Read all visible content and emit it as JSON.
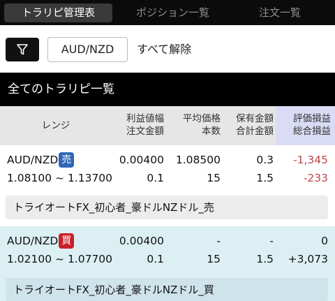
{
  "tabs": [
    {
      "label": "トラリピ管理表",
      "active": true
    },
    {
      "label": "ポジション一覧",
      "active": false
    },
    {
      "label": "注文一覧",
      "active": false
    }
  ],
  "filter": {
    "icon": "filter-icon",
    "pair": "AUD/NZD",
    "clear_label": "すべて解除"
  },
  "section_title": "全てのトラリピ一覧",
  "table_header": {
    "range": "レンジ",
    "col1": [
      "利益値幅",
      "注文金額"
    ],
    "col2": [
      "平均価格",
      "本数"
    ],
    "col3": [
      "保有金額",
      "合計金額"
    ],
    "col4": [
      "評価損益",
      "総合損益"
    ]
  },
  "rows": [
    {
      "pair": "AUD/NZD",
      "side": "売",
      "range": "1.08100 ~ 1.13700",
      "profit_width": "0.00400",
      "order_amount": "0.1",
      "avg_price": "1.08500",
      "count": "15",
      "holding_amount": "0.3",
      "total_amount": "1.5",
      "unrealized_pl": "-1,345",
      "total_pl": "-233",
      "name": "トライオートFX_初心者_豪ドルNZドル_売"
    },
    {
      "pair": "AUD/NZD",
      "side": "買",
      "range": "1.02100 ~ 1.07700",
      "profit_width": "0.00400",
      "order_amount": "0.1",
      "avg_price": "-",
      "count": "15",
      "holding_amount": "-",
      "total_amount": "1.5",
      "unrealized_pl": "0",
      "total_pl": "+3,073",
      "name": "トライオートFX_初心者_豪ドルNZドル_買"
    }
  ],
  "colors": {
    "sell_badge": "#2f67b6",
    "buy_badge": "#c8202c",
    "negative": "#c0444c",
    "buy_row_bg": "#dcf0f4",
    "pl_header_bg": "#d9dcf4"
  }
}
